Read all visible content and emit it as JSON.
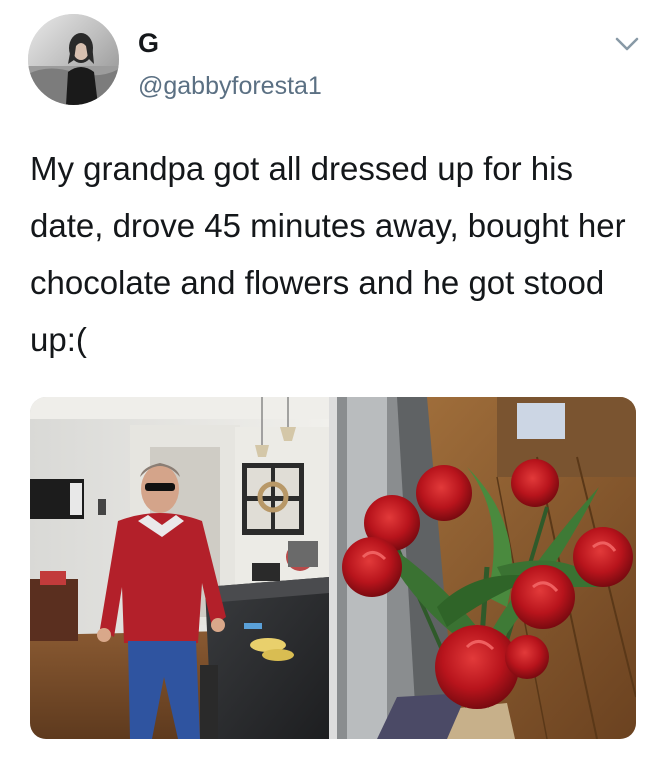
{
  "tweet": {
    "author": {
      "display_name": "G",
      "handle": "@gabbyforesta1",
      "avatar_icon": "profile-photo"
    },
    "menu_icon": "chevron-down-icon",
    "text": "My grandpa got all dressed up for his date, drove 45 minutes away, bought her chocolate and flowers and he got stood up:(",
    "media": [
      {
        "kind": "photo",
        "subject": "man-in-red-sweater-in-kitchen"
      },
      {
        "kind": "photo",
        "subject": "red-roses-bouquet"
      }
    ]
  },
  "colors": {
    "text": "#14171a",
    "secondary_text": "#5b7083",
    "chevron": "#8899a6",
    "background": "#ffffff"
  }
}
